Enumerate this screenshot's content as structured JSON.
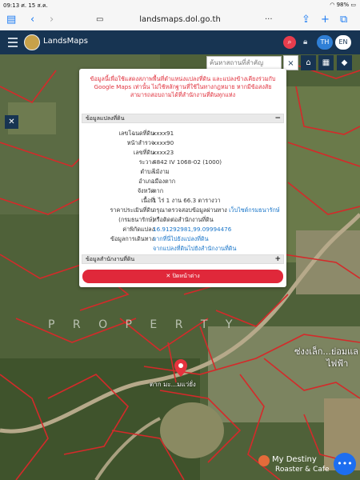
{
  "status_bar": {
    "time": "09:13",
    "date": "ศ. 15 ส.ค.",
    "battery": "98%"
  },
  "browser": {
    "url": "landsmaps.dol.go.th"
  },
  "app": {
    "title": "LandsMaps",
    "lang_th": "TH",
    "lang_en": "EN"
  },
  "map": {
    "search_placeholder": "ค้นหาสถานที่สำคัญ",
    "watermark": "P R O P E R T Y",
    "pin_label": "ตาก มะ...มแว่ยั่ง",
    "label_road": "ซ่งงเล็ก...ย่อมแล",
    "label_road2": "ไฟฟ้า"
  },
  "popup": {
    "notice": "ข้อมูลนี้เพื่อใช้แสดงสภาพพื้นที่ตำแหน่งแปลงที่ดิน และแปลงข้างเคียงร่วมกับ Google Maps เท่านั้น ไม่ใช้หลักฐานที่ใช้ในทางกฎหมาย หากมีข้อสงสัยสามารถสอบถามได้ที่สำนักงานที่ดินทุกแห่ง",
    "section_parcel": "ข้อมูลแปลงที่ดิน",
    "section_office": "ข้อมูลสำนักงานที่ดิน",
    "rows": [
      {
        "label": "เลขโฉนดที่ดิน",
        "value": "xxxx91"
      },
      {
        "label": "หน้าสำรวจ",
        "value": "xxxx90"
      },
      {
        "label": "เลขที่ดิน",
        "value": "xxxx23"
      },
      {
        "label": "ระวาง",
        "value": "4842 IV 1068-02 (1000)"
      },
      {
        "label": "ตำบล",
        "value": "ไม้งาม"
      },
      {
        "label": "อำเภอ",
        "value": "เมืองตาก"
      },
      {
        "label": "จังหวัด",
        "value": "ตาก"
      },
      {
        "label": "เนื้อที่",
        "value": "1 ไร่ 1 งาน 66.3 ตารางวา"
      }
    ],
    "price_label_1": "ราคาประเมินที่ดิน",
    "price_label_2": "(กรมธนารักษ์)",
    "price_value_1": "กรุณาตรวจสอบข้อมูลผ่านทาง",
    "price_link": "เว็บไซต์กรมธนารักษ์",
    "price_value_2": "หรือติดต่อสำนักงานที่ดิน",
    "coord_label": "ค่าพิกัดแปลง",
    "coord_value": "16.91292981,99.09994476",
    "nav_label": "ข้อมูลการเดินทาง",
    "nav_link_1": "จากที่นี่ไปยังแปลงที่ดิน",
    "nav_link_2": "จากแปลงที่ดินไปยังสำนักงานที่ดิน",
    "close_button": "ปิดหน้าต่าง",
    "minus": "−",
    "plus": "+"
  },
  "watermark_brand": {
    "line1": "My Destiny",
    "line2": "Roaster & Cafe"
  },
  "colors": {
    "appbar": "#173452",
    "close_button": "#e0283a",
    "parcel_line": "#d42a2a"
  }
}
